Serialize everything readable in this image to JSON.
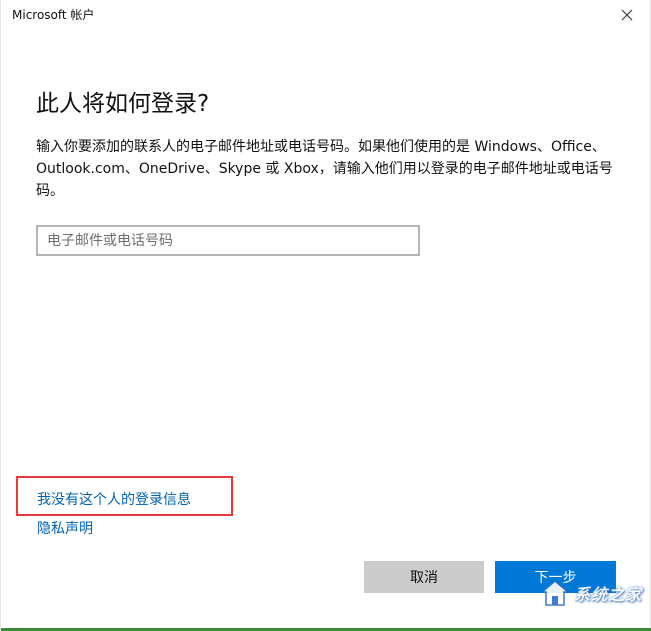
{
  "window": {
    "title": "Microsoft 帐户",
    "close_icon": "close-icon"
  },
  "main": {
    "heading": "此人将如何登录?",
    "description": "输入你要添加的联系人的电子邮件地址或电话号码。如果他们使用的是 Windows、Office、Outlook.com、OneDrive、Skype 或 Xbox，请输入他们用以登录的电子邮件地址或电话号码。",
    "email_input": {
      "value": "",
      "placeholder": "电子邮件或电话号码"
    },
    "links": {
      "no_info": "我没有这个人的登录信息",
      "privacy": "隐私声明"
    },
    "highlight_color": "#e33b3b"
  },
  "footer": {
    "cancel_label": "取消",
    "next_label": "下一步"
  },
  "watermark": {
    "text": "系统之家",
    "icon": "house-logo-icon"
  },
  "colors": {
    "accent": "#0078d7",
    "link": "#0063b1",
    "cancel_bg": "#cccccc"
  }
}
